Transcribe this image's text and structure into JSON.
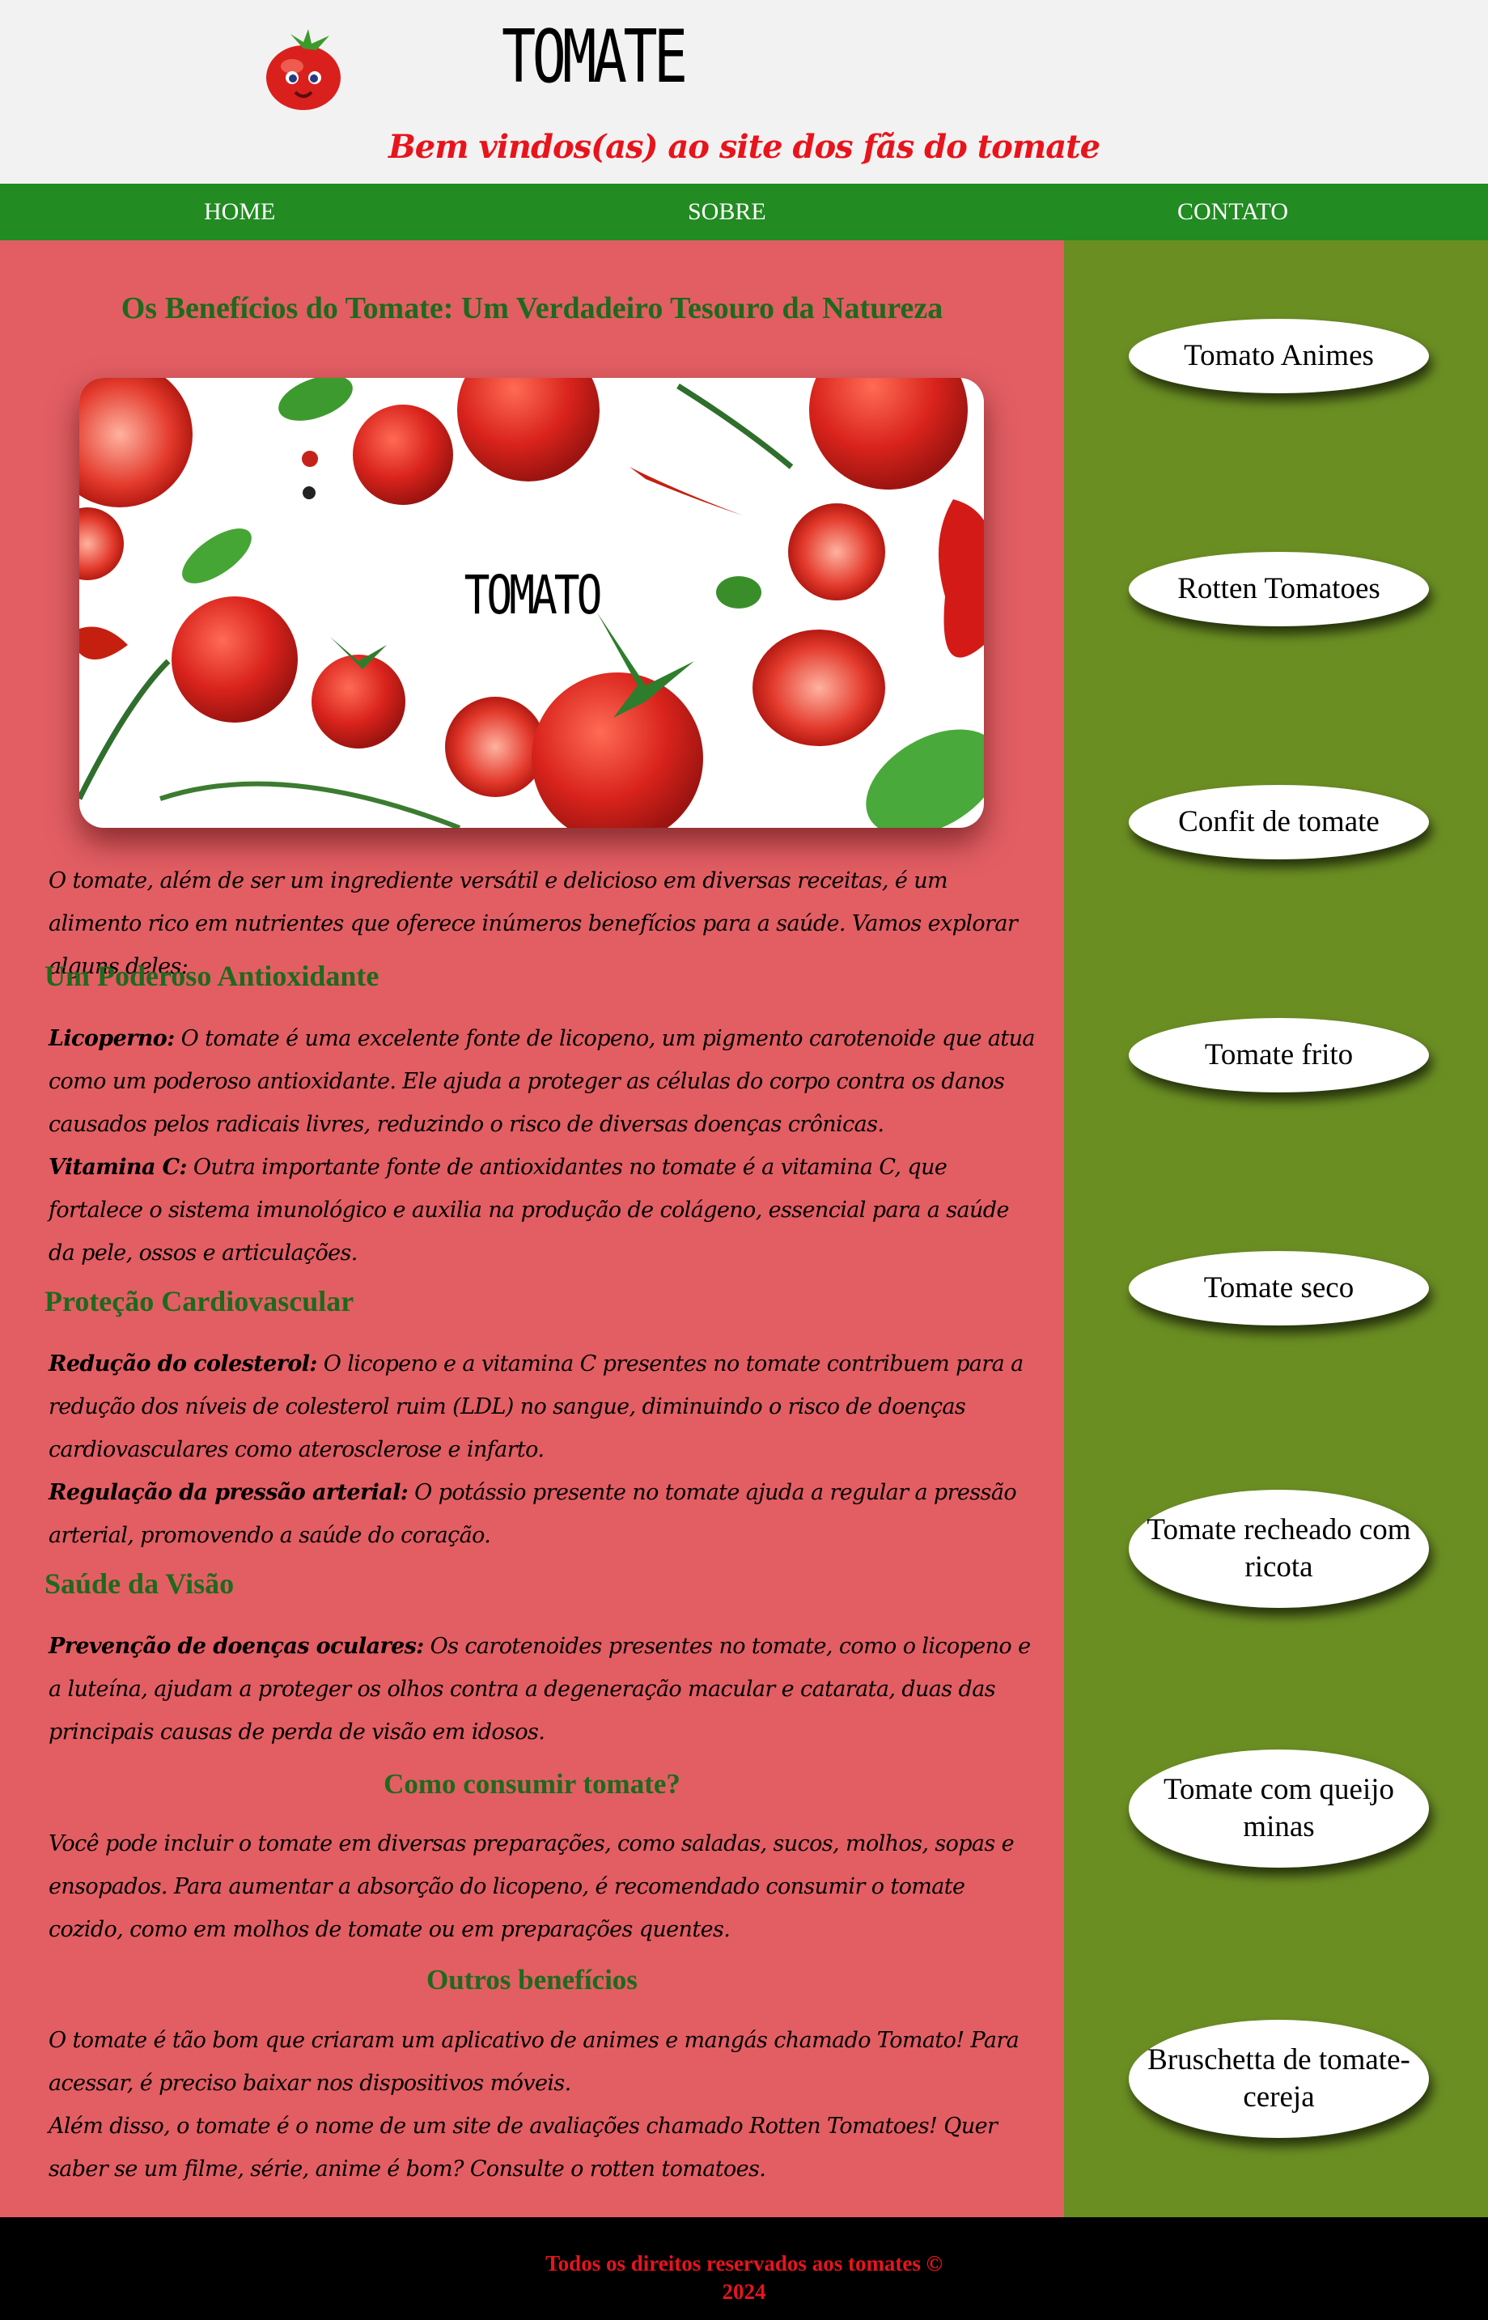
{
  "header": {
    "title": "TOMATE",
    "welcome": "Bem vindos(as) ao site dos fãs do tomate",
    "logo_icon": "tomato-mascot-icon"
  },
  "nav": {
    "items": [
      "HOME",
      "SOBRE",
      "CONTATO"
    ]
  },
  "main": {
    "heading": "Os Benefícios do Tomate: Um Verdadeiro Tesouro da Natureza",
    "hero_word": "TOMATO",
    "intro": "O tomate, além de ser um ingrediente versátil e delicioso em diversas receitas, é um alimento rico em nutrientes que oferece inúmeros benefícios para a saúde. Vamos explorar alguns deles:",
    "sections": [
      {
        "title": "Um Poderoso Antioxidante",
        "items": [
          {
            "label": "Licoperno:",
            "text": " O tomate é uma excelente fonte de licopeno, um pigmento carotenoide que atua como um poderoso antioxidante. Ele ajuda a proteger as células do corpo contra os danos causados pelos radicais livres, reduzindo o risco de diversas doenças crônicas."
          },
          {
            "label": "Vitamina C:",
            "text": " Outra importante fonte de antioxidantes no tomate é a vitamina C, que fortalece o sistema imunológico e auxilia na produção de colágeno, essencial para a saúde da pele, ossos e articulações."
          }
        ]
      },
      {
        "title": "Proteção Cardiovascular",
        "items": [
          {
            "label": "Redução do colesterol:",
            "text": " O licopeno e a vitamina C presentes no tomate contribuem para a redução dos níveis de colesterol ruim (LDL) no sangue, diminuindo o risco de doenças cardiovasculares como aterosclerose e infarto."
          },
          {
            "label": "Regulação da pressão arterial:",
            "text": " O potássio presente no tomate ajuda a regular a pressão arterial, promovendo a saúde do coração."
          }
        ]
      },
      {
        "title": "Saúde da Visão",
        "items": [
          {
            "label": "Prevenção de doenças oculares:",
            "text": " Os carotenoides presentes no tomate, como o licopeno e a luteína, ajudam a proteger os olhos contra a degeneração macular e catarata, duas das principais causas de perda de visão em idosos."
          }
        ]
      }
    ],
    "consume_title": "Como consumir tomate?",
    "consume_text": "Você pode incluir o tomate em diversas preparações, como saladas, sucos, molhos, sopas e ensopados. Para aumentar a absorção do licopeno, é recomendado consumir o tomate cozido, como em molhos de tomate ou em preparações quentes.",
    "others_title": "Outros benefícios",
    "others_p1": "O tomate é tão bom que criaram um aplicativo de animes e mangás chamado Tomato! Para acessar, é preciso baixar nos dispositivos móveis.",
    "others_p2": "Além disso, o tomate é o nome de um site de avaliações chamado Rotten Tomatoes! Quer saber se um filme, série, anime é bom? Consulte o rotten tomatoes."
  },
  "sidebar": {
    "links": [
      "Tomato Animes",
      "Rotten Tomatoes",
      "Confit de tomate",
      "Tomate frito",
      "Tomate seco",
      "Tomate recheado com ricota",
      "Tomate com queijo minas",
      "Bruschetta de tomate-cereja"
    ]
  },
  "footer": {
    "line1": "Todos os direitos reservados aos tomates ©",
    "line2": "2024"
  },
  "colors": {
    "nav_green": "#228b22",
    "main_red": "#e25e63",
    "aside_olive": "#6b8e23",
    "heading_green": "#1d6a1d",
    "accent_red": "#e8141c"
  }
}
